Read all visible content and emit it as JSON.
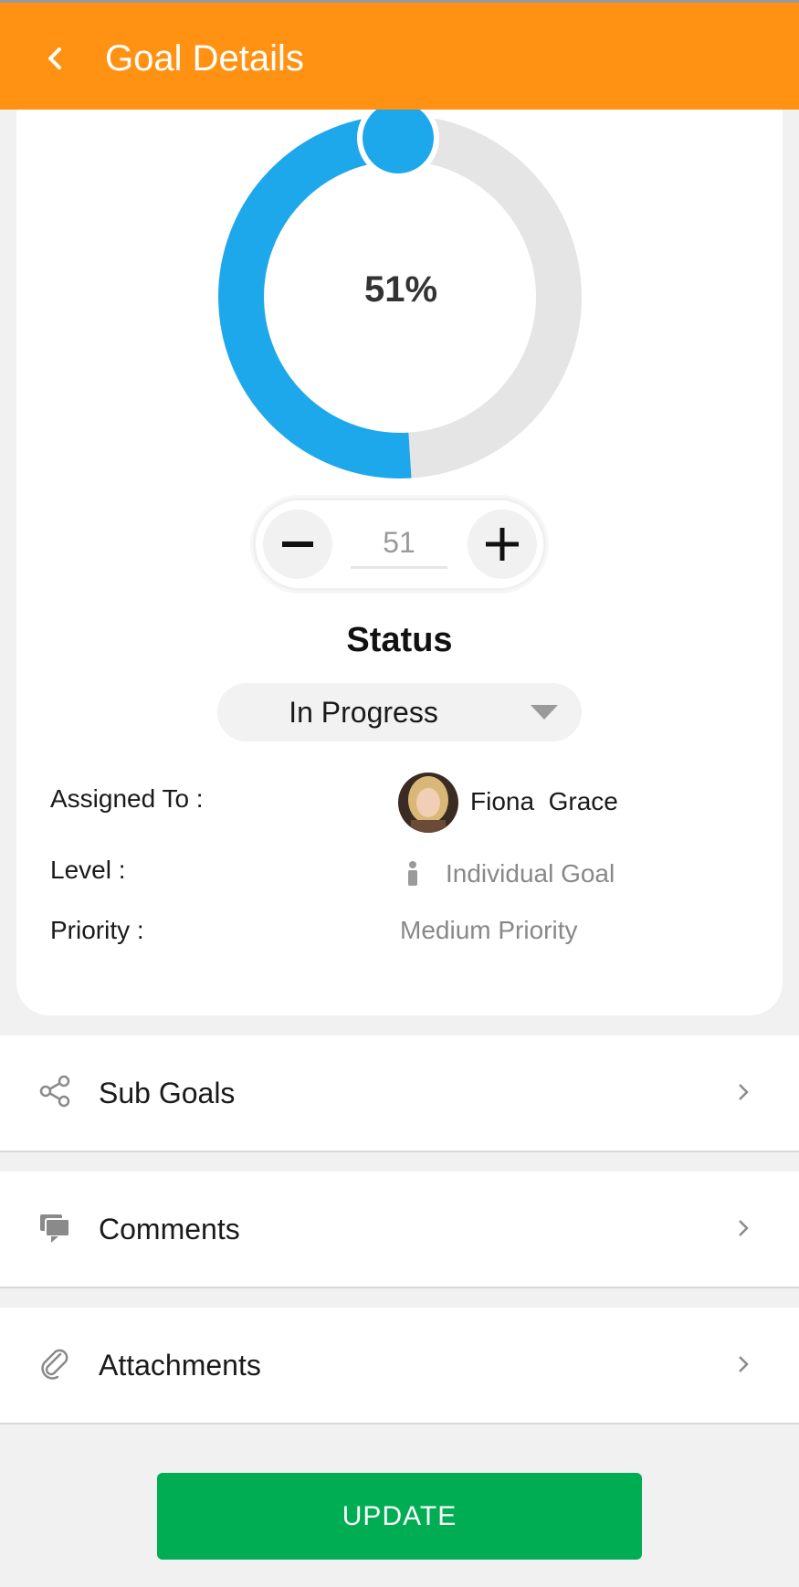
{
  "header": {
    "title": "Goal Details",
    "back_icon": "chevron-left-icon"
  },
  "progress": {
    "percent_text": "51%",
    "value": 51,
    "fraction": 0.51,
    "colors": {
      "fill": "#1ea8ec",
      "track": "#e5e5e5"
    }
  },
  "stepper": {
    "value": "51",
    "minus_icon": "minus-icon",
    "plus_icon": "plus-icon"
  },
  "status": {
    "label": "Status",
    "selected": "In Progress"
  },
  "details": {
    "assigned_label": "Assigned To :",
    "assigned_value": "Fiona  Grace",
    "level_label": "Level :",
    "level_value": "Individual Goal",
    "priority_label": "Priority :",
    "priority_value": "Medium Priority"
  },
  "sections": [
    {
      "label": "Sub Goals",
      "icon": "share-icon"
    },
    {
      "label": "Comments",
      "icon": "comment-icon"
    },
    {
      "label": "Attachments",
      "icon": "paperclip-icon"
    }
  ],
  "footer": {
    "update_label": "UPDATE"
  },
  "colors": {
    "header": "#ff9212",
    "update": "#00ad53",
    "background": "#f1f1f1"
  }
}
